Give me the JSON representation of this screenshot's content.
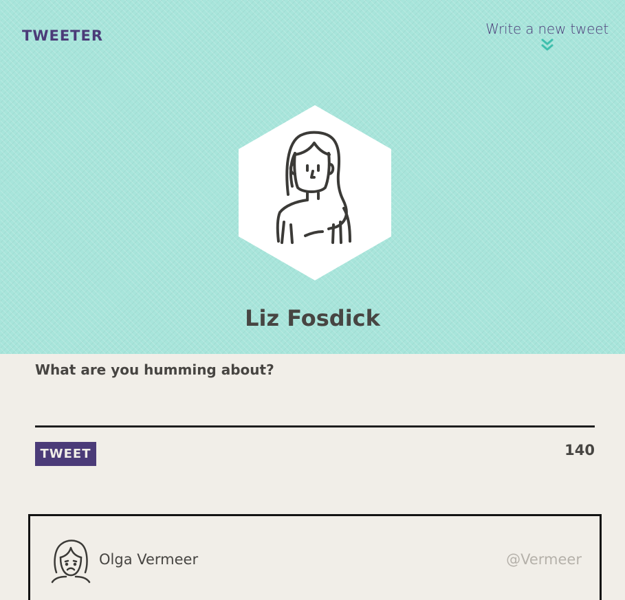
{
  "header": {
    "brand": "TWEETER",
    "write_link_label": "Write a new tweet"
  },
  "profile": {
    "name": "Liz Fosdick"
  },
  "compose": {
    "label": "What are you humming about?",
    "input_value": "",
    "button_label": "TWEET",
    "counter": "140"
  },
  "tweets": [
    {
      "author": "Olga Vermeer",
      "handle": "@Vermeer"
    }
  ],
  "colors": {
    "hero_bg": "#a8e5db",
    "brand_purple": "#4b3b78",
    "text_dark": "#474542",
    "page_bg": "#f1eee8",
    "chevron_teal": "#3fbfad",
    "handle_gray": "#b5b1aa"
  },
  "icons": {
    "write_link": "double-chevron-down-icon",
    "profile_avatar": "woman-avatar-icon",
    "tweet_avatar": "frowning-woman-avatar-icon"
  }
}
